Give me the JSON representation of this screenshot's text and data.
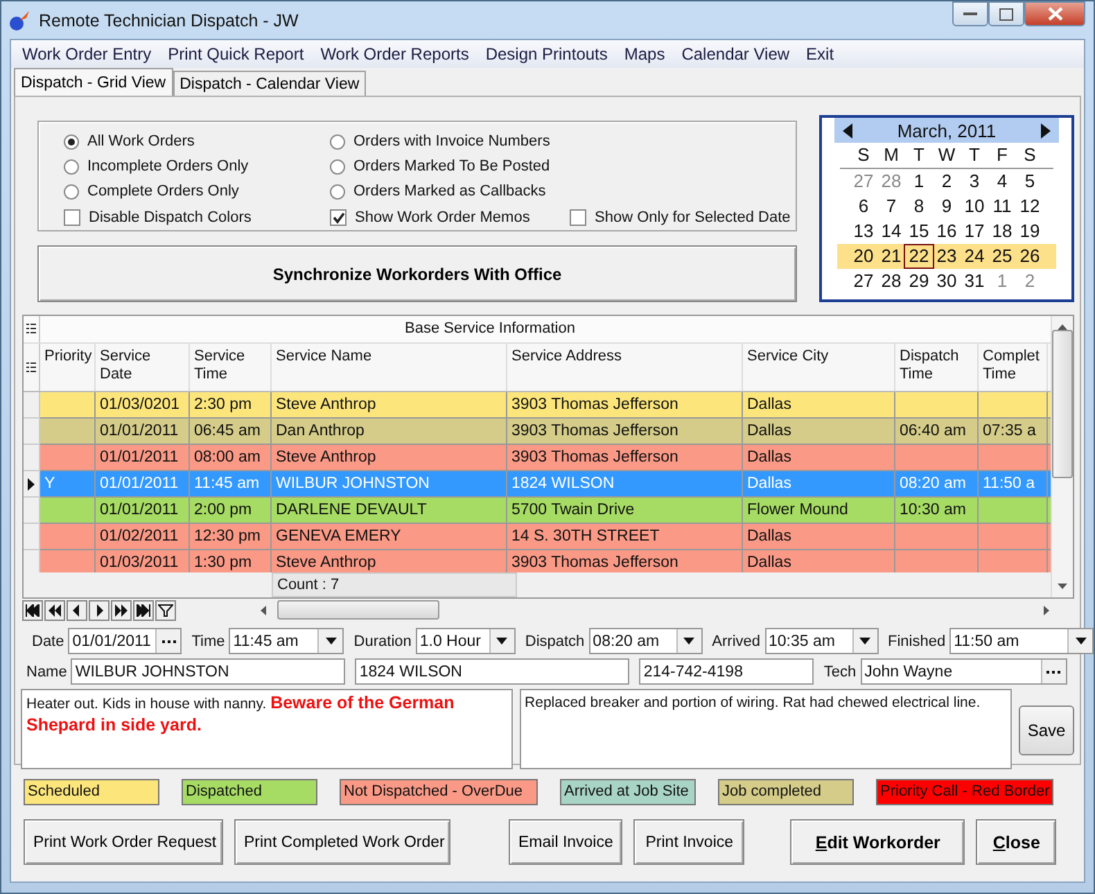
{
  "window": {
    "title": "Remote Technician Dispatch - JW"
  },
  "menu": [
    "Work Order Entry",
    "Print Quick Report",
    "Work Order Reports",
    "Design Printouts",
    "Maps",
    "Calendar View",
    "Exit"
  ],
  "tabs": [
    {
      "label": "Dispatch - Grid View",
      "selected": true
    },
    {
      "label": "Dispatch - Calendar View",
      "selected": false
    }
  ],
  "radio_options": [
    {
      "label": "All Work Orders",
      "selected": true
    },
    {
      "label": "Incomplete Orders Only",
      "selected": false
    },
    {
      "label": "Complete Orders Only",
      "selected": false
    },
    {
      "label": "Orders with Invoice Numbers",
      "selected": false
    },
    {
      "label": "Orders Marked To Be Posted",
      "selected": false
    },
    {
      "label": "Orders Marked as Callbacks",
      "selected": false
    }
  ],
  "checkboxes": [
    {
      "label": "Disable Dispatch Colors",
      "checked": false
    },
    {
      "label": "Show Work Order Memos",
      "checked": true
    },
    {
      "label": "Show Only for Selected Date",
      "checked": false
    }
  ],
  "sync_button": "Synchronize Workorders With Office",
  "calendar": {
    "month": "March, 2011",
    "weekdays": [
      "S",
      "M",
      "T",
      "W",
      "T",
      "F",
      "S"
    ],
    "weeks": [
      {
        "highlighted": false,
        "days": [
          {
            "label": "27",
            "other_month": true,
            "selected": false
          },
          {
            "label": "28",
            "other_month": true,
            "selected": false
          },
          {
            "label": "1",
            "other_month": false,
            "selected": false
          },
          {
            "label": "2",
            "other_month": false,
            "selected": false
          },
          {
            "label": "3",
            "other_month": false,
            "selected": false
          },
          {
            "label": "4",
            "other_month": false,
            "selected": false
          },
          {
            "label": "5",
            "other_month": false,
            "selected": false
          }
        ]
      },
      {
        "highlighted": false,
        "days": [
          {
            "label": "6",
            "other_month": false,
            "selected": false
          },
          {
            "label": "7",
            "other_month": false,
            "selected": false
          },
          {
            "label": "8",
            "other_month": false,
            "selected": false
          },
          {
            "label": "9",
            "other_month": false,
            "selected": false
          },
          {
            "label": "10",
            "other_month": false,
            "selected": false
          },
          {
            "label": "11",
            "other_month": false,
            "selected": false
          },
          {
            "label": "12",
            "other_month": false,
            "selected": false
          }
        ]
      },
      {
        "highlighted": false,
        "days": [
          {
            "label": "13",
            "other_month": false,
            "selected": false
          },
          {
            "label": "14",
            "other_month": false,
            "selected": false
          },
          {
            "label": "15",
            "other_month": false,
            "selected": false
          },
          {
            "label": "16",
            "other_month": false,
            "selected": false
          },
          {
            "label": "17",
            "other_month": false,
            "selected": false
          },
          {
            "label": "18",
            "other_month": false,
            "selected": false
          },
          {
            "label": "19",
            "other_month": false,
            "selected": false
          }
        ]
      },
      {
        "highlighted": true,
        "days": [
          {
            "label": "20",
            "other_month": false,
            "selected": false
          },
          {
            "label": "21",
            "other_month": false,
            "selected": false
          },
          {
            "label": "22",
            "other_month": false,
            "selected": true
          },
          {
            "label": "23",
            "other_month": false,
            "selected": false
          },
          {
            "label": "24",
            "other_month": false,
            "selected": false
          },
          {
            "label": "25",
            "other_month": false,
            "selected": false
          },
          {
            "label": "26",
            "other_month": false,
            "selected": false
          }
        ]
      },
      {
        "highlighted": false,
        "days": [
          {
            "label": "27",
            "other_month": false,
            "selected": false
          },
          {
            "label": "28",
            "other_month": false,
            "selected": false
          },
          {
            "label": "29",
            "other_month": false,
            "selected": false
          },
          {
            "label": "30",
            "other_month": false,
            "selected": false
          },
          {
            "label": "31",
            "other_month": false,
            "selected": false
          },
          {
            "label": "1",
            "other_month": true,
            "selected": false
          },
          {
            "label": "2",
            "other_month": true,
            "selected": false
          }
        ]
      }
    ]
  },
  "grid": {
    "group_header": "Base Service Information",
    "columns": [
      "Priority",
      "Service Date",
      "Service Time",
      "Service Name",
      "Service Address",
      "Service City",
      "Dispatch Time",
      "Complet Time"
    ],
    "rows": [
      {
        "selected": false,
        "color": "#fce67c",
        "cells": [
          null,
          "01/03/0201",
          "2:30 pm",
          "Steve Anthrop",
          "3903 Thomas Jefferson",
          "Dallas",
          null,
          null
        ]
      },
      {
        "selected": false,
        "color": "#d4cc88",
        "cells": [
          null,
          "01/01/2011",
          "06:45 am",
          "Dan Anthrop",
          "3903 Thomas Jefferson",
          "Dallas",
          "06:40 am",
          "07:35 a"
        ]
      },
      {
        "selected": false,
        "color": "#fa9986",
        "cells": [
          null,
          "01/01/2011",
          "08:00 am",
          "Steve Anthrop",
          "3903 Thomas Jefferson",
          "Dallas",
          null,
          null
        ]
      },
      {
        "selected": true,
        "cells": [
          "Y",
          "01/01/2011",
          "11:45 am",
          "WILBUR JOHNSTON",
          "1824 WILSON",
          "Dallas",
          "08:20 am",
          "11:50 a"
        ]
      },
      {
        "selected": false,
        "color": "#a6dc64",
        "cells": [
          null,
          "01/01/2011",
          "2:00 pm",
          "DARLENE DEVAULT",
          "5700 Twain Drive",
          "Flower Mound",
          "10:30 am",
          null
        ]
      },
      {
        "selected": false,
        "color": "#fa9986",
        "cells": [
          null,
          "01/02/2011",
          "12:30 pm",
          "GENEVA EMERY",
          "14 S. 30TH STREET",
          "Dallas",
          null,
          null
        ]
      },
      {
        "selected": false,
        "color": "#fa9986",
        "cells": [
          null,
          "01/03/2011",
          "1:30 pm",
          "Steve Anthrop",
          "3903 Thomas Jefferson",
          "Dallas",
          null,
          null
        ]
      }
    ],
    "count": "Count : 7"
  },
  "schedule_fields": [
    {
      "label": "Date",
      "value": "01/01/2011",
      "kind": "picker"
    },
    {
      "label": "Time",
      "value": "11:45 am",
      "kind": "dropdown"
    },
    {
      "label": "Duration",
      "value": "1.0 Hour",
      "kind": "dropdown"
    },
    {
      "label": "Dispatch",
      "value": "08:20 am",
      "kind": "dropdown"
    },
    {
      "label": "Arrived",
      "value": "10:35 am",
      "kind": "dropdown"
    },
    {
      "label": "Finished",
      "value": "11:50 am",
      "kind": "dropdown"
    }
  ],
  "customer_fields": [
    {
      "label": "Name",
      "value": "WILBUR JOHNSTON",
      "kind": "text"
    },
    {
      "value": "1824 WILSON",
      "kind": "text"
    },
    {
      "value": "214-742-4198",
      "kind": "text"
    },
    {
      "label": "Tech",
      "value": "John Wayne",
      "kind": "picker"
    }
  ],
  "work_memo": "Heater out.  Kids in house with nanny. **Beware of the German Shepard in side yard.**",
  "tech_memo": "Replaced breaker and portion of wiring.  Rat had chewed electrical line.",
  "save_button": "Save",
  "legend": [
    {
      "label": "Scheduled",
      "color": "#fce67c"
    },
    {
      "label": "Dispatched",
      "color": "#a6dc64"
    },
    {
      "label": "Not Dispatched - OverDue",
      "color": "#fa9986"
    },
    {
      "label": "Arrived at Job Site",
      "color": "#a8d4c6"
    },
    {
      "label": "Job completed",
      "color": "#d4cc88"
    },
    {
      "label": "Priority Call - Red Border",
      "color": "#ff0000"
    }
  ],
  "buttons": [
    {
      "label": "Print Work Order Request",
      "bold": false
    },
    {
      "label": "Print Completed Work Order",
      "bold": false
    },
    {
      "label": "Email Invoice",
      "bold": false
    },
    {
      "label": "Print Invoice",
      "bold": false
    },
    {
      "label": "Edit Workorder",
      "bold": true
    },
    {
      "label": "Close",
      "bold": true
    }
  ]
}
